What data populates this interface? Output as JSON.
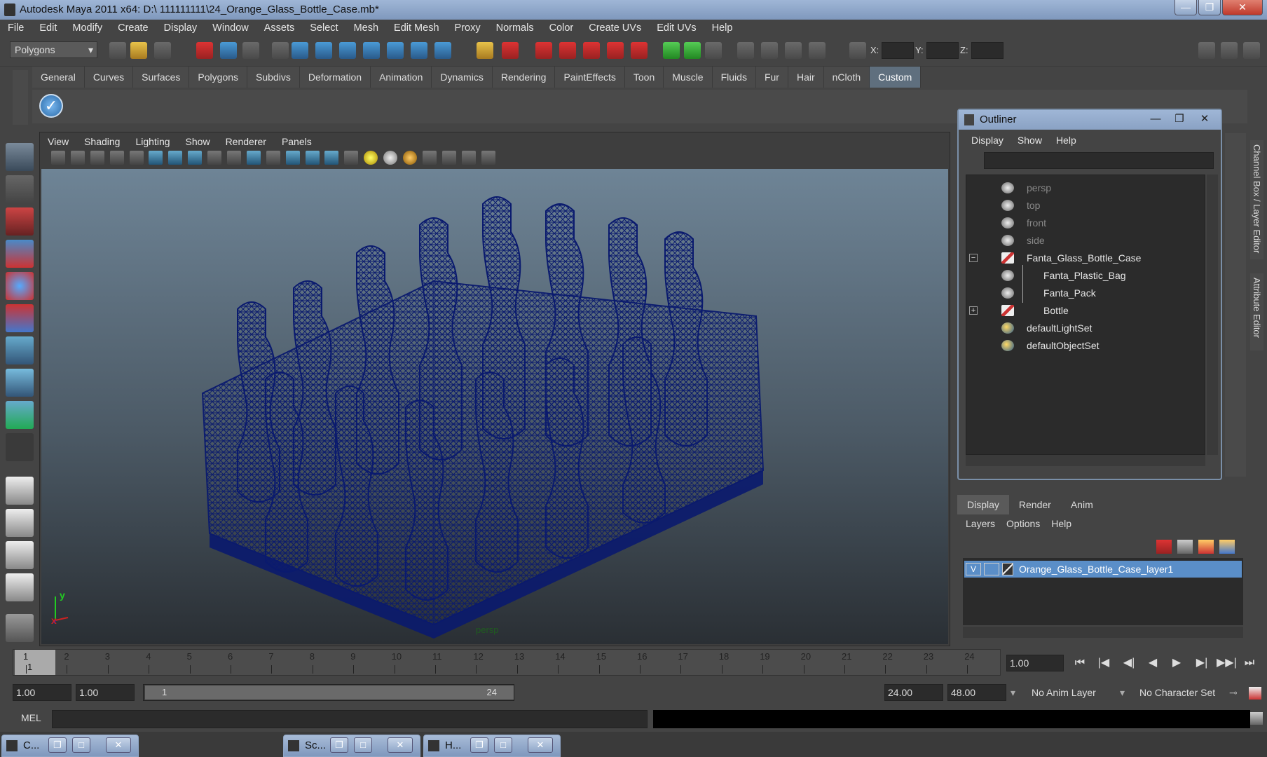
{
  "window": {
    "title": "Autodesk Maya 2011 x64: D:\\ 111111111\\24_Orange_Glass_Bottle_Case.mb*",
    "minimize": "—",
    "maximize": "❐",
    "close": "✕"
  },
  "menubar": [
    "File",
    "Edit",
    "Modify",
    "Create",
    "Display",
    "Window",
    "Assets",
    "Select",
    "Mesh",
    "Edit Mesh",
    "Proxy",
    "Normals",
    "Color",
    "Create UVs",
    "Edit UVs",
    "Help"
  ],
  "status": {
    "mode": "Polygons",
    "x_label": "X:",
    "y_label": "Y:",
    "z_label": "Z:"
  },
  "shelf": {
    "tabs": [
      "General",
      "Curves",
      "Surfaces",
      "Polygons",
      "Subdivs",
      "Deformation",
      "Animation",
      "Dynamics",
      "Rendering",
      "PaintEffects",
      "Toon",
      "Muscle",
      "Fluids",
      "Fur",
      "Hair",
      "nCloth",
      "Custom"
    ],
    "active_tab": "Custom"
  },
  "viewport": {
    "menus": [
      "View",
      "Shading",
      "Lighting",
      "Show",
      "Renderer",
      "Panels"
    ],
    "camera_label": "persp",
    "axis_y": "y",
    "axis_x": "x"
  },
  "outliner": {
    "title": "Outliner",
    "menus": [
      "Display",
      "Show",
      "Help"
    ],
    "items": [
      {
        "label": "persp",
        "dim": true
      },
      {
        "label": "top",
        "dim": true
      },
      {
        "label": "front",
        "dim": true
      },
      {
        "label": "side",
        "dim": true
      },
      {
        "label": "Fanta_Glass_Bottle_Case",
        "dim": false
      },
      {
        "label": "Fanta_Plastic_Bag",
        "dim": false
      },
      {
        "label": "Fanta_Pack",
        "dim": false
      },
      {
        "label": "Bottle",
        "dim": false
      },
      {
        "label": "defaultLightSet",
        "dim": false
      },
      {
        "label": "defaultObjectSet",
        "dim": false
      }
    ],
    "collapse_symbol": "−",
    "expand_symbol": "+"
  },
  "side_tabs": {
    "channel_box": "Channel Box / Layer Editor",
    "attribute_editor": "Attribute Editor"
  },
  "layer_editor": {
    "tabs": [
      "Display",
      "Render",
      "Anim"
    ],
    "active_tab": "Display",
    "menus": [
      "Layers",
      "Options",
      "Help"
    ],
    "layer": {
      "visible": "V",
      "name": "Orange_Glass_Bottle_Case_layer1"
    }
  },
  "timeline": {
    "frames": [
      "1",
      "2",
      "3",
      "4",
      "5",
      "6",
      "7",
      "8",
      "9",
      "10",
      "11",
      "12",
      "13",
      "14",
      "15",
      "16",
      "17",
      "18",
      "19",
      "20",
      "21",
      "22",
      "23",
      "24"
    ],
    "current_frame_label": "1",
    "current_time": "1.00"
  },
  "range": {
    "start_time": "1.00",
    "playback_start": "1.00",
    "range_start_label": "1",
    "range_end_label": "24",
    "playback_end": "24.00",
    "end_time": "48.00",
    "anim_layer": "No Anim Layer",
    "character_set": "No Character Set"
  },
  "playback": [
    "⏮",
    "|◀",
    "◀|",
    "◀",
    "▶",
    "▶|",
    "▶▶|",
    "⏭"
  ],
  "command": {
    "label": "MEL"
  },
  "taskbar": [
    {
      "label": "C..."
    },
    {
      "label": "Sc..."
    },
    {
      "label": "H..."
    }
  ],
  "colors": {
    "accent": "#5a8ec8",
    "wireframe": "#0a1a6e",
    "shelf_active": "#5f6f7e"
  }
}
